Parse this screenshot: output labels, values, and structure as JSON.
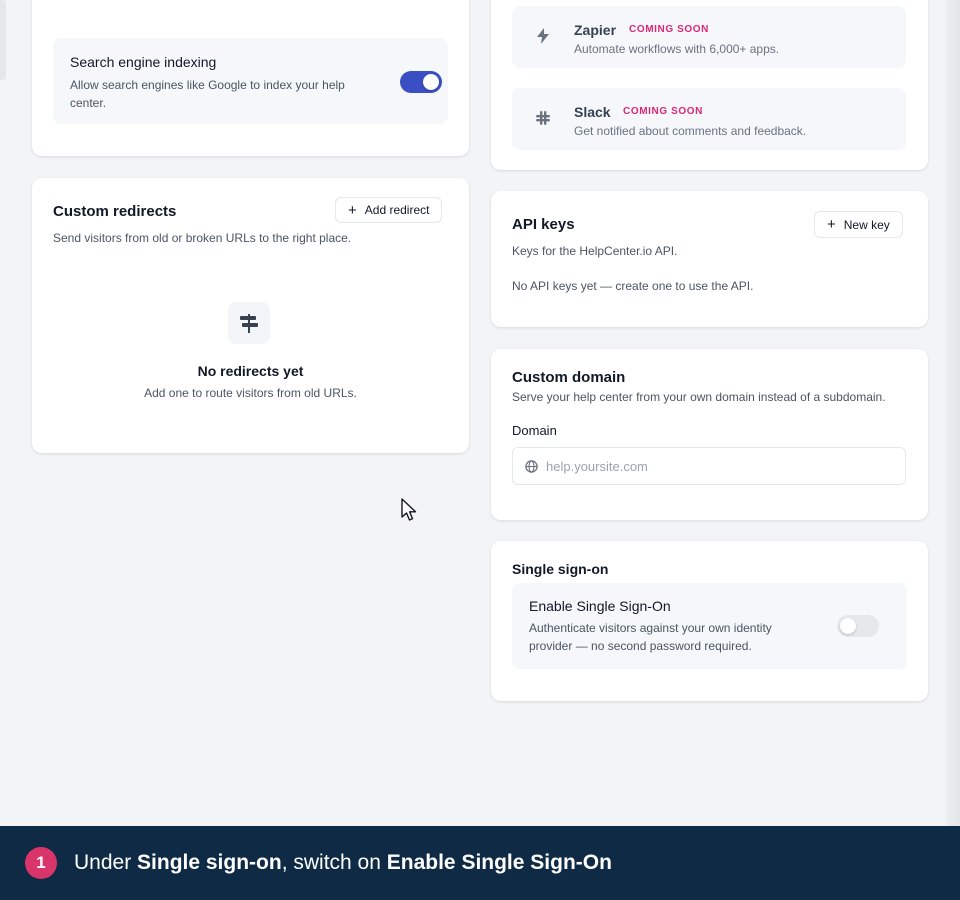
{
  "seo": {
    "title": "Search engine indexing",
    "desc": "Allow search engines like Google to index your help center.",
    "enabled": true
  },
  "redirects": {
    "title": "Custom redirects",
    "desc": "Send visitors from old or broken URLs to the right place.",
    "add_label": "Add redirect",
    "empty_title": "No redirects yet",
    "empty_desc": "Add one to route visitors from old URLs."
  },
  "integrations": [
    {
      "name": "Zapier",
      "badge": "COMING SOON",
      "desc": "Automate workflows with 6,000+ apps.",
      "icon": "lightning-icon"
    },
    {
      "name": "Slack",
      "badge": "COMING SOON",
      "desc": "Get notified about comments and feedback.",
      "icon": "slack-icon"
    }
  ],
  "api_keys": {
    "title": "API keys",
    "new_label": "New key",
    "desc": "Keys for the HelpCenter.io API.",
    "empty": "No API keys yet — create one to use the API."
  },
  "domain": {
    "title": "Custom domain",
    "desc": "Serve your help center from your own domain instead of a subdomain.",
    "label": "Domain",
    "placeholder": "help.yoursite.com",
    "value": ""
  },
  "sso": {
    "title": "Single sign-on",
    "row_title": "Enable Single Sign-On",
    "row_desc": "Authenticate visitors against your own identity provider — no second password required.",
    "enabled": false
  },
  "banner": {
    "step": "1",
    "prefix": "Under ",
    "section": "Single sign-on",
    "middle": ", switch on ",
    "target": "Enable Single Sign-On"
  },
  "colors": {
    "accent": "#3b4fc4",
    "badge": "#db2777",
    "banner_bg": "#0f2a44",
    "step_badge": "#d9356a"
  }
}
